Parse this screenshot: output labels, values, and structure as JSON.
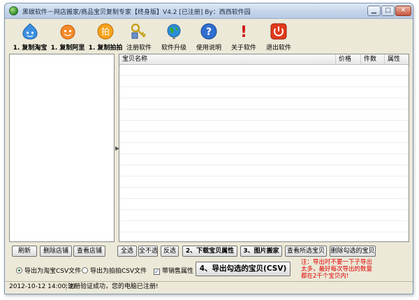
{
  "window": {
    "title": "黑碳软件－网店搬家/商品宝贝复制专家【终身版】V4.2 [已注册] By：西西软件园",
    "controls": {
      "minimize": "▁",
      "maximize": "□",
      "close": "✕"
    }
  },
  "toolbar": {
    "items": [
      {
        "label": "1. 复制淘宝",
        "icon": "taobao-face-icon"
      },
      {
        "label": "1. 复制阿里",
        "icon": "alibaba-face-icon"
      },
      {
        "label": "1. 复制拍拍",
        "icon": "paipai-icon",
        "glyph": "拍"
      },
      {
        "label": "注册软件",
        "icon": "key-icon"
      },
      {
        "label": "软件升级",
        "icon": "globe-icon"
      },
      {
        "label": "使用说明",
        "icon": "help-icon",
        "glyph": "?"
      },
      {
        "label": "关于软件",
        "icon": "alert-icon",
        "glyph": "!"
      },
      {
        "label": "退出软件",
        "icon": "power-icon"
      }
    ]
  },
  "grid": {
    "columns": [
      "宝贝名称",
      "价格",
      "件数",
      "属性"
    ]
  },
  "splitter": {
    "grip": "▶"
  },
  "left_buttons": [
    "刷新",
    "删除店铺",
    "查看店铺"
  ],
  "right_buttons": {
    "select_all": "全选",
    "select_none": "全不选",
    "invert": "反选",
    "download_attrs": "2、下载宝贝属性",
    "image_move": "3、图片搬家",
    "view_selected": "查看所选宝贝",
    "delete_checked": "删除勾选的宝贝"
  },
  "export": {
    "radio_taobao": "导出为淘宝CSV文件",
    "radio_paipai": "导出为拍拍CSV文件",
    "checkbox_sales": "带销售属性",
    "checkbox_mark": "✓",
    "export_button": "4、导出勾选的宝贝(CSV)"
  },
  "note": {
    "lines": [
      "注：导出时不要一下子导出",
      "太多，最好每次导出的数量",
      "都在2千个宝贝内!"
    ]
  },
  "status": {
    "time": "2012-10-12 14:00:39",
    "message": "注册验证成功，您的电脑已注册!"
  },
  "colors": {
    "note": "#e00000",
    "title_bar": "#c4d5ea",
    "window_bg": "#ece9d8"
  }
}
